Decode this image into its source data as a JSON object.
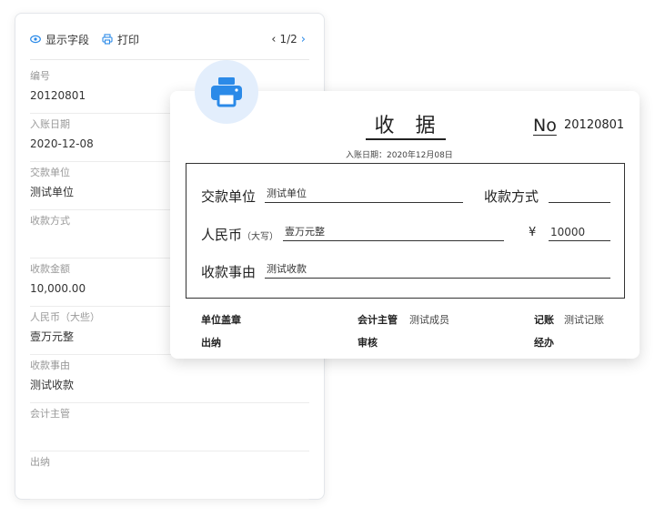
{
  "toolbar": {
    "show_fields_label": "显示字段",
    "print_label": "打印",
    "pager": "1/2"
  },
  "fields": [
    {
      "label": "编号",
      "value": "20120801"
    },
    {
      "label": "入账日期",
      "value": "2020-12-08"
    },
    {
      "label": "交款单位",
      "value": "测试单位"
    },
    {
      "label": "收款方式",
      "value": ""
    },
    {
      "label": "收款金额",
      "value": "10,000.00"
    },
    {
      "label": "人民币（大些）",
      "value": "壹万元整"
    },
    {
      "label": "收款事由",
      "value": "测试收款"
    },
    {
      "label": "会计主管",
      "value": ""
    },
    {
      "label": "出纳",
      "value": ""
    }
  ],
  "receipt": {
    "title": "收 据",
    "no_label": "No",
    "no_value": "20120801",
    "date": "入账日期：2020年12月08日",
    "payer_label": "交款单位",
    "payer_value": "测试单位",
    "method_label": "收款方式",
    "method_value": "",
    "rmb_label": "人民币",
    "rmb_sub": "（大写）",
    "rmb_value": "壹万元整",
    "yen_symbol": "¥",
    "amount_value": "10000",
    "reason_label": "收款事由",
    "reason_value": "测试收款",
    "footer": {
      "seal_label": "单位盖章",
      "supervisor_label": "会计主管",
      "supervisor_value": "测试成员",
      "bookkeeper_label": "记账",
      "bookkeeper_value": "测试记账",
      "cashier_label": "出纳",
      "reviewer_label": "审核",
      "handler_label": "经办"
    }
  },
  "colors": {
    "accent": "#2b8ae8",
    "print_bubble": "#e3eefc"
  }
}
